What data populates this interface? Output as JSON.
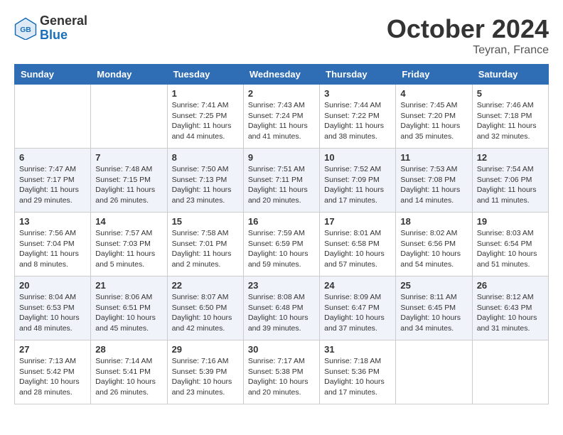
{
  "header": {
    "logo_general": "General",
    "logo_blue": "Blue",
    "month_title": "October 2024",
    "location": "Teyran, France"
  },
  "calendar": {
    "columns": [
      "Sunday",
      "Monday",
      "Tuesday",
      "Wednesday",
      "Thursday",
      "Friday",
      "Saturday"
    ],
    "weeks": [
      [
        {
          "day": "",
          "sunrise": "",
          "sunset": "",
          "daylight": ""
        },
        {
          "day": "",
          "sunrise": "",
          "sunset": "",
          "daylight": ""
        },
        {
          "day": "1",
          "sunrise": "Sunrise: 7:41 AM",
          "sunset": "Sunset: 7:25 PM",
          "daylight": "Daylight: 11 hours and 44 minutes."
        },
        {
          "day": "2",
          "sunrise": "Sunrise: 7:43 AM",
          "sunset": "Sunset: 7:24 PM",
          "daylight": "Daylight: 11 hours and 41 minutes."
        },
        {
          "day": "3",
          "sunrise": "Sunrise: 7:44 AM",
          "sunset": "Sunset: 7:22 PM",
          "daylight": "Daylight: 11 hours and 38 minutes."
        },
        {
          "day": "4",
          "sunrise": "Sunrise: 7:45 AM",
          "sunset": "Sunset: 7:20 PM",
          "daylight": "Daylight: 11 hours and 35 minutes."
        },
        {
          "day": "5",
          "sunrise": "Sunrise: 7:46 AM",
          "sunset": "Sunset: 7:18 PM",
          "daylight": "Daylight: 11 hours and 32 minutes."
        }
      ],
      [
        {
          "day": "6",
          "sunrise": "Sunrise: 7:47 AM",
          "sunset": "Sunset: 7:17 PM",
          "daylight": "Daylight: 11 hours and 29 minutes."
        },
        {
          "day": "7",
          "sunrise": "Sunrise: 7:48 AM",
          "sunset": "Sunset: 7:15 PM",
          "daylight": "Daylight: 11 hours and 26 minutes."
        },
        {
          "day": "8",
          "sunrise": "Sunrise: 7:50 AM",
          "sunset": "Sunset: 7:13 PM",
          "daylight": "Daylight: 11 hours and 23 minutes."
        },
        {
          "day": "9",
          "sunrise": "Sunrise: 7:51 AM",
          "sunset": "Sunset: 7:11 PM",
          "daylight": "Daylight: 11 hours and 20 minutes."
        },
        {
          "day": "10",
          "sunrise": "Sunrise: 7:52 AM",
          "sunset": "Sunset: 7:09 PM",
          "daylight": "Daylight: 11 hours and 17 minutes."
        },
        {
          "day": "11",
          "sunrise": "Sunrise: 7:53 AM",
          "sunset": "Sunset: 7:08 PM",
          "daylight": "Daylight: 11 hours and 14 minutes."
        },
        {
          "day": "12",
          "sunrise": "Sunrise: 7:54 AM",
          "sunset": "Sunset: 7:06 PM",
          "daylight": "Daylight: 11 hours and 11 minutes."
        }
      ],
      [
        {
          "day": "13",
          "sunrise": "Sunrise: 7:56 AM",
          "sunset": "Sunset: 7:04 PM",
          "daylight": "Daylight: 11 hours and 8 minutes."
        },
        {
          "day": "14",
          "sunrise": "Sunrise: 7:57 AM",
          "sunset": "Sunset: 7:03 PM",
          "daylight": "Daylight: 11 hours and 5 minutes."
        },
        {
          "day": "15",
          "sunrise": "Sunrise: 7:58 AM",
          "sunset": "Sunset: 7:01 PM",
          "daylight": "Daylight: 11 hours and 2 minutes."
        },
        {
          "day": "16",
          "sunrise": "Sunrise: 7:59 AM",
          "sunset": "Sunset: 6:59 PM",
          "daylight": "Daylight: 10 hours and 59 minutes."
        },
        {
          "day": "17",
          "sunrise": "Sunrise: 8:01 AM",
          "sunset": "Sunset: 6:58 PM",
          "daylight": "Daylight: 10 hours and 57 minutes."
        },
        {
          "day": "18",
          "sunrise": "Sunrise: 8:02 AM",
          "sunset": "Sunset: 6:56 PM",
          "daylight": "Daylight: 10 hours and 54 minutes."
        },
        {
          "day": "19",
          "sunrise": "Sunrise: 8:03 AM",
          "sunset": "Sunset: 6:54 PM",
          "daylight": "Daylight: 10 hours and 51 minutes."
        }
      ],
      [
        {
          "day": "20",
          "sunrise": "Sunrise: 8:04 AM",
          "sunset": "Sunset: 6:53 PM",
          "daylight": "Daylight: 10 hours and 48 minutes."
        },
        {
          "day": "21",
          "sunrise": "Sunrise: 8:06 AM",
          "sunset": "Sunset: 6:51 PM",
          "daylight": "Daylight: 10 hours and 45 minutes."
        },
        {
          "day": "22",
          "sunrise": "Sunrise: 8:07 AM",
          "sunset": "Sunset: 6:50 PM",
          "daylight": "Daylight: 10 hours and 42 minutes."
        },
        {
          "day": "23",
          "sunrise": "Sunrise: 8:08 AM",
          "sunset": "Sunset: 6:48 PM",
          "daylight": "Daylight: 10 hours and 39 minutes."
        },
        {
          "day": "24",
          "sunrise": "Sunrise: 8:09 AM",
          "sunset": "Sunset: 6:47 PM",
          "daylight": "Daylight: 10 hours and 37 minutes."
        },
        {
          "day": "25",
          "sunrise": "Sunrise: 8:11 AM",
          "sunset": "Sunset: 6:45 PM",
          "daylight": "Daylight: 10 hours and 34 minutes."
        },
        {
          "day": "26",
          "sunrise": "Sunrise: 8:12 AM",
          "sunset": "Sunset: 6:43 PM",
          "daylight": "Daylight: 10 hours and 31 minutes."
        }
      ],
      [
        {
          "day": "27",
          "sunrise": "Sunrise: 7:13 AM",
          "sunset": "Sunset: 5:42 PM",
          "daylight": "Daylight: 10 hours and 28 minutes."
        },
        {
          "day": "28",
          "sunrise": "Sunrise: 7:14 AM",
          "sunset": "Sunset: 5:41 PM",
          "daylight": "Daylight: 10 hours and 26 minutes."
        },
        {
          "day": "29",
          "sunrise": "Sunrise: 7:16 AM",
          "sunset": "Sunset: 5:39 PM",
          "daylight": "Daylight: 10 hours and 23 minutes."
        },
        {
          "day": "30",
          "sunrise": "Sunrise: 7:17 AM",
          "sunset": "Sunset: 5:38 PM",
          "daylight": "Daylight: 10 hours and 20 minutes."
        },
        {
          "day": "31",
          "sunrise": "Sunrise: 7:18 AM",
          "sunset": "Sunset: 5:36 PM",
          "daylight": "Daylight: 10 hours and 17 minutes."
        },
        {
          "day": "",
          "sunrise": "",
          "sunset": "",
          "daylight": ""
        },
        {
          "day": "",
          "sunrise": "",
          "sunset": "",
          "daylight": ""
        }
      ]
    ]
  }
}
